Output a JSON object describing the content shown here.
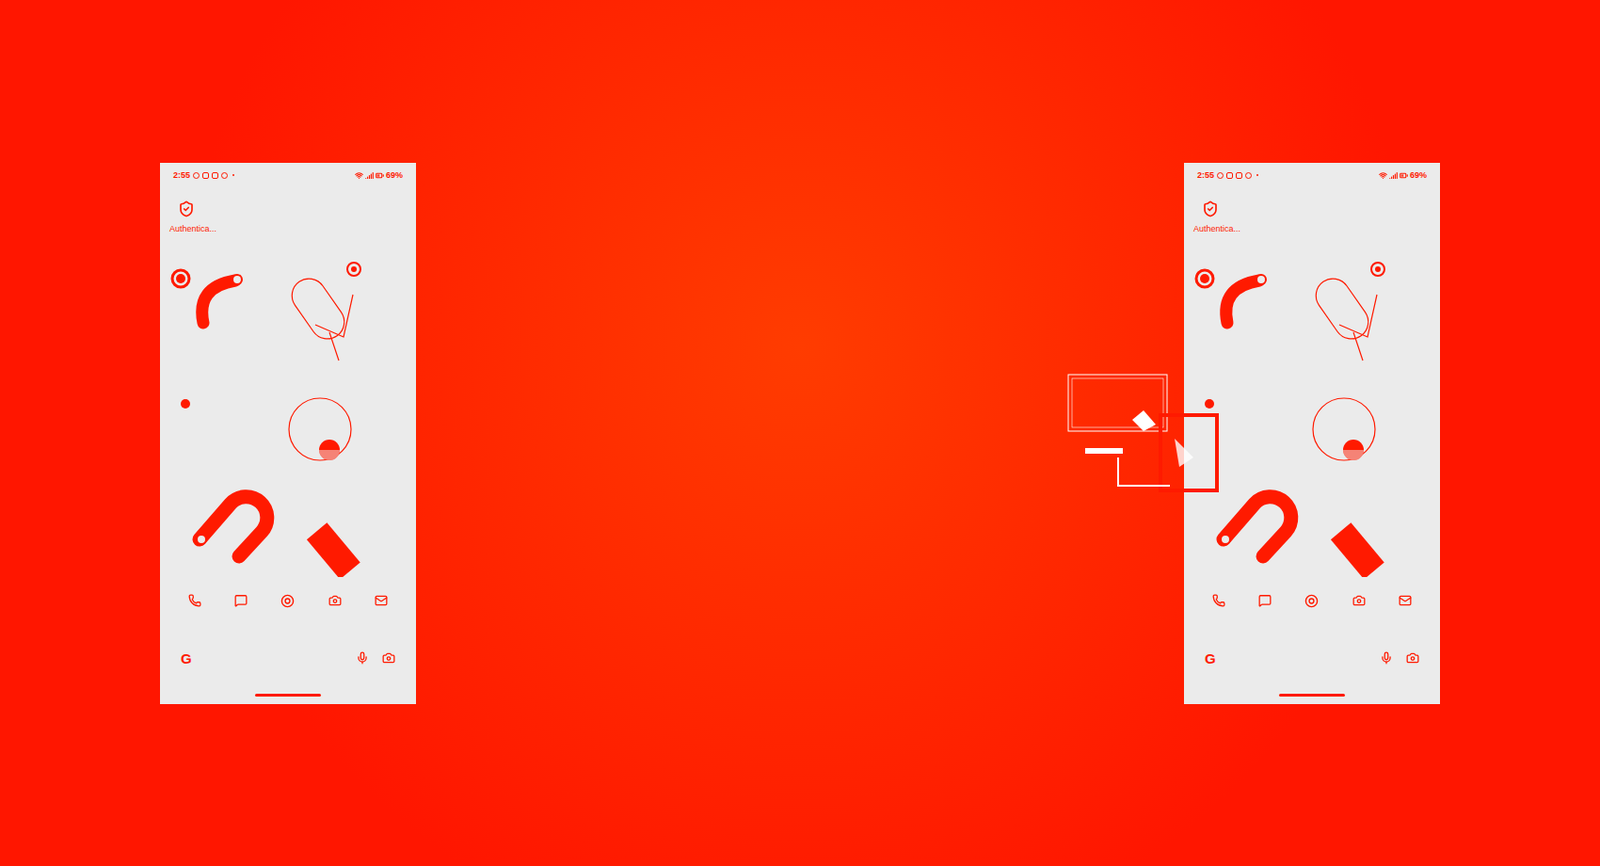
{
  "screens": [
    {
      "status_time": "2:55",
      "battery": "69%",
      "app_label": "Authentica...",
      "search_logo": "G"
    },
    {
      "status_time": "2:55",
      "battery": "69%",
      "app_label": "Authentica...",
      "search_logo": "G"
    }
  ]
}
